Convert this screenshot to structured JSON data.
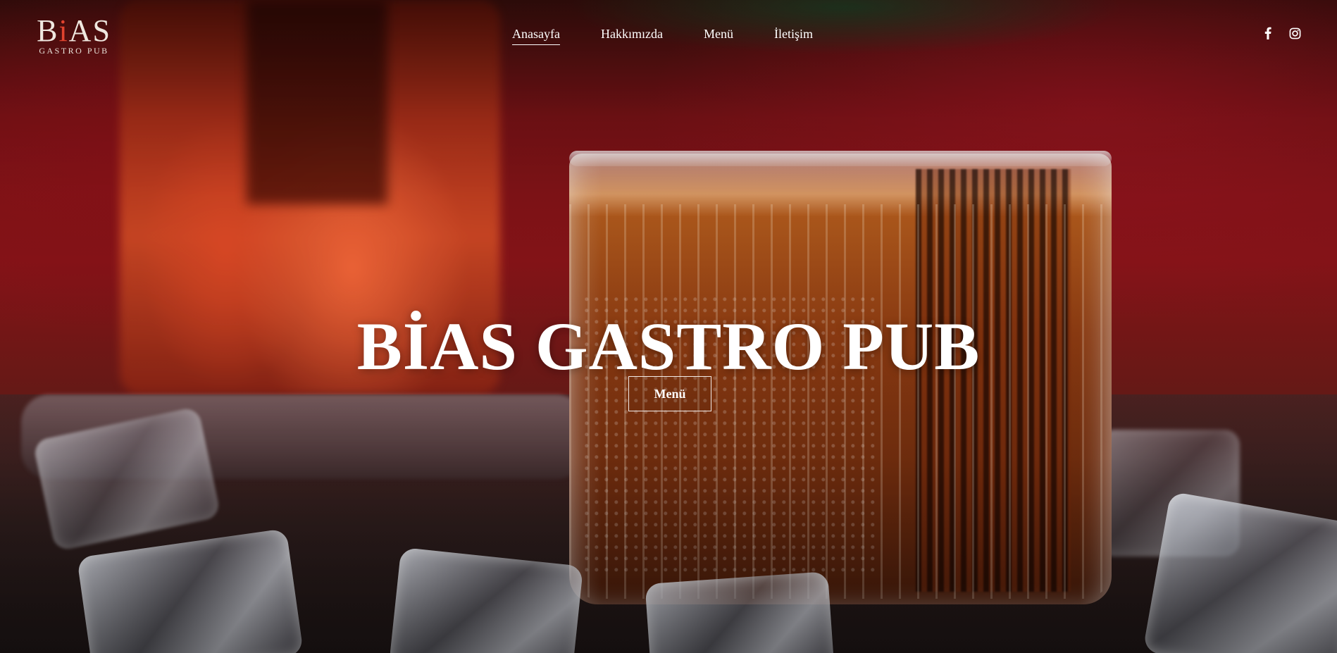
{
  "brand": {
    "logo_main_prefix": "B",
    "logo_main_dot": "i",
    "logo_main_suffix": "AS",
    "logo_sub": "GASTRO PUB"
  },
  "nav": {
    "items": [
      {
        "label": "Anasayfa",
        "active": true
      },
      {
        "label": "Hakkımızda",
        "active": false
      },
      {
        "label": "Menü",
        "active": false
      },
      {
        "label": "İletişim",
        "active": false
      }
    ]
  },
  "social": {
    "icons": [
      "facebook-icon",
      "instagram-icon"
    ]
  },
  "hero": {
    "title": "BİAS GASTRO PUB",
    "button_label": "Menü"
  },
  "colors": {
    "accent": "#e2432e",
    "text": "#ffffff",
    "background": "#7a1216"
  }
}
